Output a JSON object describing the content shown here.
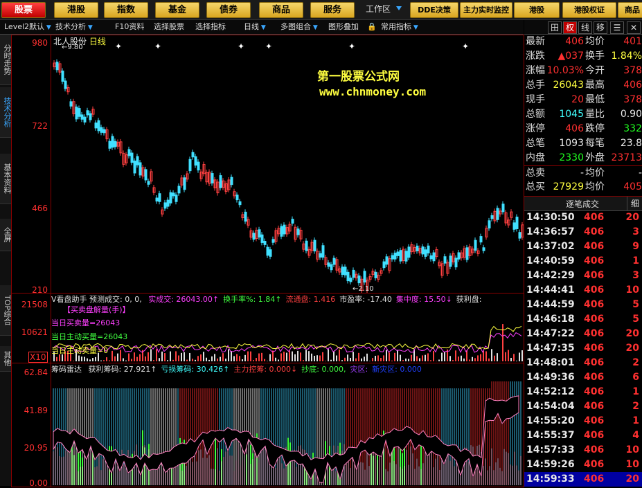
{
  "top_nav": {
    "buttons": [
      "股票",
      "港股",
      "指数",
      "基金",
      "债券",
      "商品",
      "服务"
    ],
    "workspace_label": "工作区",
    "right_buttons": [
      "DDE决策",
      "主力实时监控",
      "港股",
      "港股权证",
      "商品"
    ]
  },
  "toolbar": {
    "items": [
      "Level2默认",
      "技术分析",
      "F10资料",
      "选择股票",
      "选择指标",
      "日线",
      "多图组合",
      "图形叠加",
      "常用指标"
    ],
    "right_items": [
      "田",
      "权",
      "线",
      "移",
      "☰",
      "✕"
    ]
  },
  "left_tabs": [
    "分时走势",
    "技术分析",
    "基本资料",
    "全屏",
    "TOP综合",
    "其他"
  ],
  "main_chart": {
    "stock_name": "北人股份",
    "period": "日线",
    "watermark_title": "第一股票公式网",
    "watermark_url": "www.chnmoney.com",
    "y_ticks": [
      "980",
      "722",
      "466",
      "210"
    ],
    "high_label": "9.80",
    "low_label": "2.10"
  },
  "volume_panel": {
    "header": "V看盘助手 预测成交: 0, 0,",
    "header_items": [
      {
        "text": "实成交: 26043.00↑",
        "color": "#ff40ff"
      },
      {
        "text": "换手率%: 1.84↑",
        "color": "#40ff40"
      },
      {
        "text": "流通盘: 1.416",
        "color": "#ff4040"
      },
      {
        "text": "市盈率: -17.40",
        "color": "#e0e0e0"
      },
      {
        "text": "集中度: 15.50↓",
        "color": "#ff40ff"
      },
      {
        "text": "获利盘:",
        "color": "#e0e0e0"
      }
    ],
    "sub_title": "【买卖盘解量(手)】",
    "lines": [
      "当日买卖量=26043",
      "当日主动买量=26043",
      "当日主动卖量=0"
    ],
    "y_ticks": [
      "21508",
      "10621"
    ],
    "unit": "X10"
  },
  "chip_panel": {
    "header_name": "筹码雷达",
    "items": [
      {
        "text": "获利筹码: 27.921↑",
        "color": "#e0e0e0"
      },
      {
        "text": "亏损筹码: 30.426↑",
        "color": "#40ffff"
      },
      {
        "text": "主力控筹: 0.000↓",
        "color": "#ff4040"
      },
      {
        "text": "抄底: 0.000,",
        "color": "#40ff40"
      },
      {
        "text": "灾区:",
        "color": "#a040ff"
      },
      {
        "text": "新灾区: 0.000",
        "color": "#2040ff"
      }
    ],
    "y_ticks": [
      "62.84",
      "41.89",
      "20.95",
      "0.00"
    ]
  },
  "quote": {
    "rows": [
      {
        "k": "最新",
        "v": "406",
        "vc": "red",
        "k2": "均价",
        "v2": "401",
        "v2c": "red"
      },
      {
        "k": "涨跌",
        "v": "▲037",
        "vc": "red",
        "k2": "换手",
        "v2": "1.84%",
        "v2c": "yel"
      },
      {
        "k": "涨幅",
        "v": "10.03%",
        "vc": "red",
        "k2": "今开",
        "v2": "378",
        "v2c": "red"
      },
      {
        "k": "总手",
        "v": "26043",
        "vc": "yel",
        "k2": "最高",
        "v2": "406",
        "v2c": "red"
      },
      {
        "k": "现手",
        "v": "20",
        "vc": "red",
        "k2": "最低",
        "v2": "378",
        "v2c": "red"
      },
      {
        "k": "总额",
        "v": "1045",
        "vc": "cyan",
        "k2": "量比",
        "v2": "0.90",
        "v2c": "wht"
      },
      {
        "k": "涨停",
        "v": "406",
        "vc": "red",
        "k2": "跌停",
        "v2": "332",
        "v2c": "grn"
      },
      {
        "k": "总笔",
        "v": "1093",
        "vc": "wht",
        "k2": "每笔",
        "v2": "23.8",
        "v2c": "wht"
      },
      {
        "k": "内盘",
        "v": "2330",
        "vc": "grn",
        "k2": "外盘",
        "v2": "23713",
        "v2c": "red"
      },
      {
        "k": "总卖",
        "v": "-",
        "vc": "wht",
        "k2": "均价",
        "v2": "-",
        "v2c": "wht"
      },
      {
        "k": "总买",
        "v": "27929",
        "vc": "yel",
        "k2": "均价",
        "v2": "405",
        "v2c": "red"
      }
    ]
  },
  "trades": {
    "header": "逐笔成交",
    "detail_tab": "细",
    "rows": [
      {
        "t": "14:30:50",
        "p": "406",
        "v": "20"
      },
      {
        "t": "14:36:57",
        "p": "406",
        "v": "3"
      },
      {
        "t": "14:37:02",
        "p": "406",
        "v": "9"
      },
      {
        "t": "14:40:59",
        "p": "406",
        "v": "1"
      },
      {
        "t": "14:42:29",
        "p": "406",
        "v": "3"
      },
      {
        "t": "14:44:41",
        "p": "406",
        "v": "10"
      },
      {
        "t": "14:44:59",
        "p": "406",
        "v": "5"
      },
      {
        "t": "14:46:18",
        "p": "406",
        "v": "5"
      },
      {
        "t": "14:47:22",
        "p": "406",
        "v": "20"
      },
      {
        "t": "14:47:35",
        "p": "406",
        "v": "20"
      },
      {
        "t": "14:48:01",
        "p": "406",
        "v": "2"
      },
      {
        "t": "14:49:36",
        "p": "406",
        "v": "6"
      },
      {
        "t": "14:52:12",
        "p": "406",
        "v": "1"
      },
      {
        "t": "14:54:04",
        "p": "406",
        "v": "2"
      },
      {
        "t": "14:55:20",
        "p": "406",
        "v": "1"
      },
      {
        "t": "14:55:37",
        "p": "406",
        "v": "4"
      },
      {
        "t": "14:57:33",
        "p": "406",
        "v": "10"
      },
      {
        "t": "14:59:26",
        "p": "406",
        "v": "10"
      },
      {
        "t": "14:59:33",
        "p": "406",
        "v": "20"
      }
    ]
  },
  "colors": {
    "up": "#ff3030",
    "down": "#40ffff",
    "border": "#8b0000",
    "selected": "#0000a0"
  }
}
